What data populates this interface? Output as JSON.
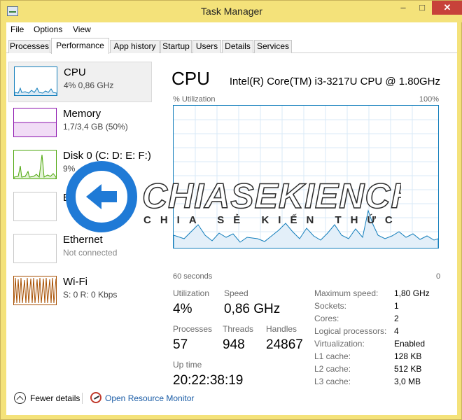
{
  "window": {
    "title": "Task Manager",
    "controls": {
      "minimize": "–",
      "maximize": "□",
      "close": "✕"
    }
  },
  "menu": [
    "File",
    "Options",
    "View"
  ],
  "tabs": [
    "Processes",
    "Performance",
    "App history",
    "Startup",
    "Users",
    "Details",
    "Services"
  ],
  "sidebar": [
    {
      "name": "CPU",
      "sub": "4% 0,86 GHz",
      "color": "#117dbb"
    },
    {
      "name": "Memory",
      "sub": "1,7/3,4 GB (50%)",
      "color": "#8b12ae"
    },
    {
      "name": "Disk 0 (C: D: E: F:)",
      "sub": "9%",
      "color": "#4da60c"
    },
    {
      "name": "B",
      "sub": "",
      "color": "#c8c8c8"
    },
    {
      "name": "Ethernet",
      "sub": "Not connected",
      "color": "#c8c8c8"
    },
    {
      "name": "Wi-Fi",
      "sub": "S: 0 R: 0 Kbps",
      "color": "#a74f01"
    }
  ],
  "cpu": {
    "title": "CPU",
    "model": "Intel(R) Core(TM) i3-3217U CPU @ 1.80GHz",
    "graph": {
      "top_left": "% Utilization",
      "top_right": "100%",
      "bottom_left": "60 seconds",
      "bottom_right": "0"
    },
    "stats": {
      "utilization_label": "Utilization",
      "utilization": "4%",
      "speed_label": "Speed",
      "speed": "0,86 GHz",
      "processes_label": "Processes",
      "processes": "57",
      "threads_label": "Threads",
      "threads": "948",
      "handles_label": "Handles",
      "handles": "24867",
      "uptime_label": "Up time",
      "uptime": "20:22:38:19"
    },
    "specs": [
      {
        "k": "Maximum speed:",
        "v": "1,80 GHz"
      },
      {
        "k": "Sockets:",
        "v": "1"
      },
      {
        "k": "Cores:",
        "v": "2"
      },
      {
        "k": "Logical processors:",
        "v": "4"
      },
      {
        "k": "Virtualization:",
        "v": "Enabled"
      },
      {
        "k": "L1 cache:",
        "v": "128 KB"
      },
      {
        "k": "L2 cache:",
        "v": "512 KB"
      },
      {
        "k": "L3 cache:",
        "v": "3,0 MB"
      }
    ]
  },
  "footer": {
    "fewer": "Fewer details",
    "resource_monitor": "Open Resource Monitor"
  },
  "watermark": {
    "brand": "CHIASEKIENCHUC",
    "tagline": "CHIA SẺ KIẾN THỨC"
  }
}
